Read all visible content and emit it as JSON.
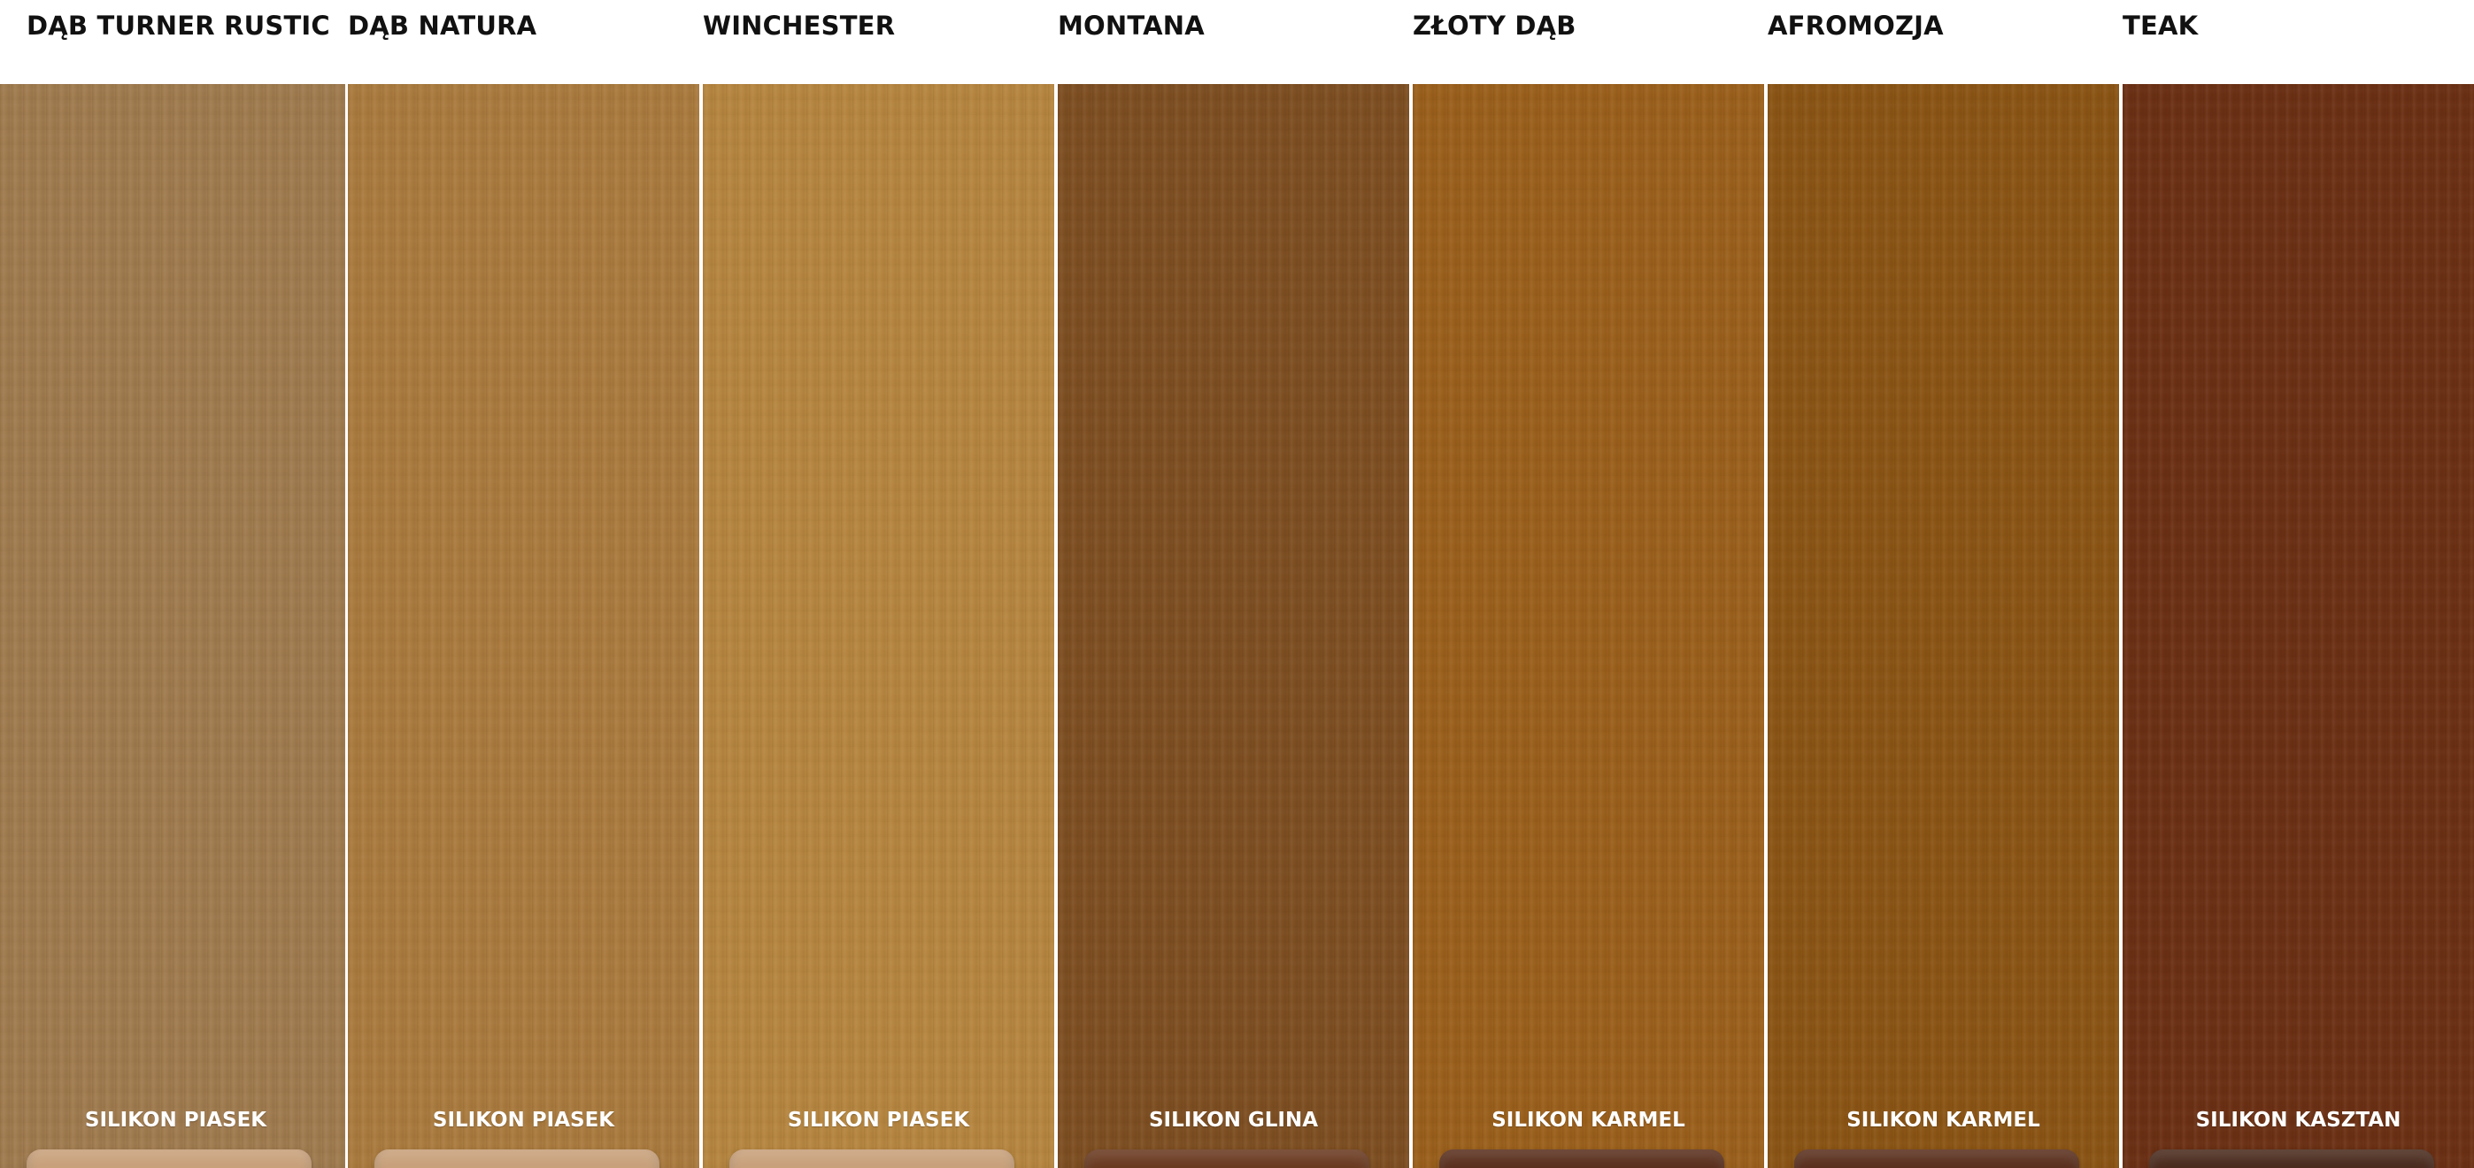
{
  "swatches": [
    {
      "name": "DĄB TURNER RUSTIC",
      "silicone": "SILIKON PIASEK",
      "wood_color": "#9f7a4e",
      "silicone_color": "#c8a07a"
    },
    {
      "name": "DĄB NATURA",
      "silicone": "SILIKON PIASEK",
      "wood_color": "#a97a3e",
      "silicone_color": "#c8a07a"
    },
    {
      "name": "WINCHESTER",
      "silicone": "SILIKON PIASEK",
      "wood_color": "#b5853f",
      "silicone_color": "#c8a07a"
    },
    {
      "name": "MONTANA",
      "silicone": "SILIKON GLINA",
      "wood_color": "#7d4e21",
      "silicone_color": "#6a3a20"
    },
    {
      "name": "ZŁOTY DĄB",
      "silicone": "SILIKON KARMEL",
      "wood_color": "#9a5f1b",
      "silicone_color": "#5a2f1d"
    },
    {
      "name": "AFROMOZJA",
      "silicone": "SILIKON KARMEL",
      "wood_color": "#8a5414",
      "silicone_color": "#5a2f1d"
    },
    {
      "name": "TEAK",
      "silicone": "SILIKON KASZTAN",
      "wood_color": "#6b3014",
      "silicone_color": "#4a2b1d"
    }
  ]
}
